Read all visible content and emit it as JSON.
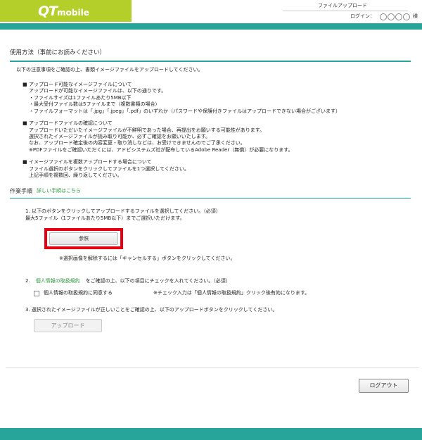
{
  "header": {
    "logo_qt": "QT",
    "logo_mobile": "mobile",
    "page_name": "ファイルアップロード",
    "login_label": "ログイン：",
    "login_suffix": "様"
  },
  "colors": {
    "accent": "#27a59a",
    "brand": "#b4cf2a",
    "highlight": "#e50012",
    "link": "#2a9a3c"
  },
  "usage": {
    "title": "使用方法（事前にお読みください）",
    "intro": "以下の注意事項をご確認の上、書類イメージファイルをアップロードしてください。",
    "blocks": [
      {
        "head": "アップロード可能なイメージファイルについて",
        "lines": [
          "アップロードが可能なイメージファイルは、以下の通りです。",
          "・ファイルサイズは1ファイルあたり5MB以下",
          "・最大受付ファイル数は5ファイルまで（複数書類の場合）",
          "・ファイルフォーマットは「.jpg」「.jpeg」「.pdf」のいずれか（パスワードや保護付きファイルはアップロードできない場合がございます）"
        ]
      },
      {
        "head": "アップロードファイルの確認について",
        "lines": [
          "アップロードいただいたイメージファイルが不鮮明であった場合、再提出をお願いする可能性があります。",
          "選択されたイメージファイルが読み取り可能か、必ずご確認をお願いいたします。",
          "なお、アップロード確定後の内容変更・取り消しなどは、お受けできませんのでご了承ください。",
          "※PDFファイルをご確認いただくには、アドビシステムズ社が配布しているAdobe Reader（無償）が必要になります。"
        ]
      },
      {
        "head": "イメージファイルを複数アップロードする場合について",
        "lines": [
          "ファイル選択のボタンをクリックしてファイルを1つ選択してください。",
          "上記手順を複数回、繰り返してください。"
        ]
      }
    ]
  },
  "work": {
    "title": "作業手順",
    "detail_link": "詳しい手順はこちら",
    "step1_line1": "1. 以下のボタンをクリックしてアップロードするファイルを選択してください。（必須）",
    "step1_line2": "最大5ファイル（1ファイルあたり5MB以下）までご選択いただけます。",
    "browse_label": "参照",
    "step1_note": "※選択画像を解除するには「キャンセルする」ボタンをクリックしてください。",
    "step2_num": "2.",
    "step2_link": "個人情報の取扱規約",
    "step2_text": "をご確認の上、以下の項目にチェックを入れてください。（必須）",
    "agree_label": "個人情報の取扱規約に同意する",
    "agree_note": "※チェック入力は「個人情報の取扱規約」クリック後有効になります。",
    "step3_text": "3. 選択されたイメージファイルが正しいことをご確認の上、以下のアップロードボタンをクリックしてください。",
    "upload_label": "アップロード"
  },
  "logout_label": "ログアウト"
}
